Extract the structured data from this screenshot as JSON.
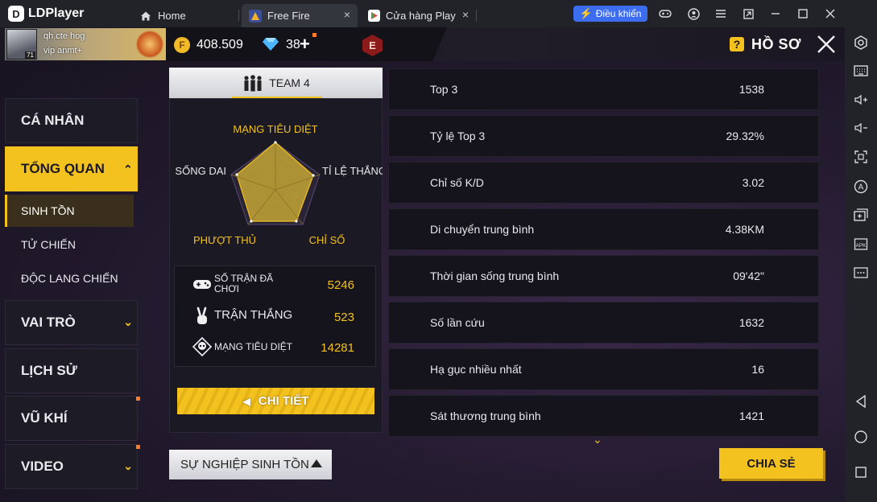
{
  "window": {
    "app_name": "LDPlayer",
    "tabs": [
      {
        "label": "Home",
        "icon": "home-icon"
      },
      {
        "label": "Free Fire",
        "icon": "free-fire-app-icon"
      },
      {
        "label": "Cửa hàng Play",
        "icon": "play-store-icon"
      }
    ],
    "control_button": "Điều khiển"
  },
  "game": {
    "player": {
      "name": "qh.cte hog",
      "subtitle": "vip anmt+",
      "level": "71"
    },
    "gold": "408.509",
    "diamonds": "38",
    "badge_letter": "E",
    "page_title": "HỒ SƠ",
    "nav": [
      {
        "label": "CÁ NHÂN"
      },
      {
        "label": "TỔNG QUAN"
      },
      {
        "label": "VAI TRÒ"
      },
      {
        "label": "LỊCH SỬ"
      },
      {
        "label": "VŨ KHÍ"
      },
      {
        "label": "VIDEO"
      }
    ],
    "sub_nav": [
      {
        "label": "SINH TỒN"
      },
      {
        "label": "TỬ CHIẾN"
      },
      {
        "label": "ĐỘC LANG CHIẾN"
      }
    ],
    "team_label": "TEAM 4",
    "radar": {
      "labels": {
        "top": "MẠNG TIÊU DIỆT",
        "left": "SỐNG DAI",
        "right": "TỈ LỆ THẮNG",
        "bottom_left": "PHƯỢT THỦ",
        "bottom_right": "CHỈ SỐ"
      }
    },
    "summary": [
      {
        "label": "SỐ TRẬN ĐÃ CHƠI",
        "value": "5246",
        "icon": "gamepad-icon"
      },
      {
        "label": "TRẬN THẮNG",
        "value": "523",
        "icon": "victory-hand-icon"
      },
      {
        "label": "MẠNG TIÊU DIỆT",
        "value": "14281",
        "icon": "skull-icon"
      }
    ],
    "detail_button": "CHI TIẾT",
    "career_button": "SỰ NGHIỆP SINH TỒN",
    "share_button": "CHIA SẺ",
    "stats": [
      {
        "label": "Top 3",
        "value": "1538"
      },
      {
        "label": "Tỷ lệ Top 3",
        "value": "29.32%"
      },
      {
        "label": "Chỉ số K/D",
        "value": "3.02"
      },
      {
        "label": "Di chuyển trung bình",
        "value": "4.38KM"
      },
      {
        "label": "Thời gian sống trung bình",
        "value": "09'42\""
      },
      {
        "label": "Số lần cứu",
        "value": "1632"
      },
      {
        "label": "Hạ gục nhiều nhất",
        "value": "16"
      },
      {
        "label": "Sát thương trung bình",
        "value": "1421"
      }
    ]
  },
  "colors": {
    "accent": "#f4c21f",
    "panel": "#15131b",
    "titlebar": "#212329"
  }
}
